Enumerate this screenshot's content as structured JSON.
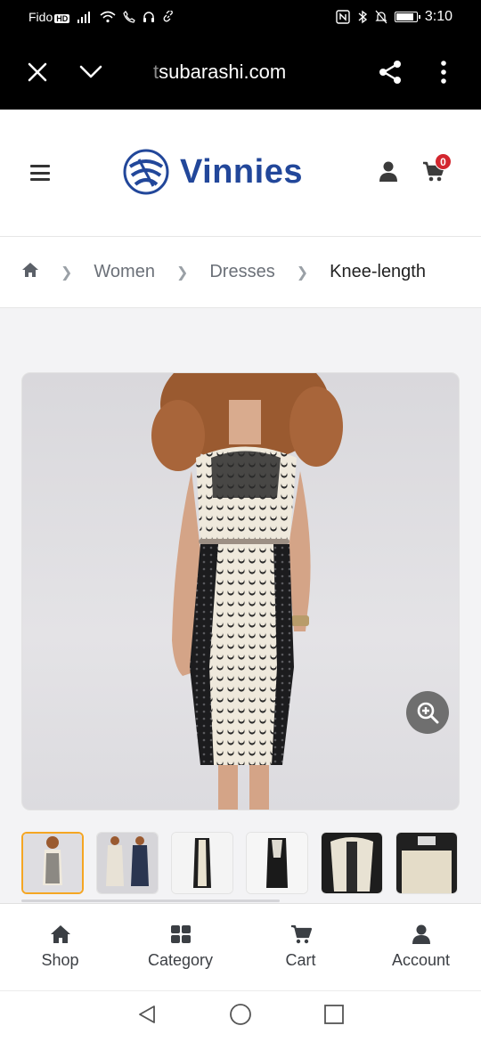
{
  "status_bar": {
    "carrier": "Fido",
    "carrier_badge": "HD",
    "time": "3:10",
    "battery_percent": 80,
    "icons": [
      "signal-icon",
      "wifi-icon",
      "call-icon",
      "headset-icon",
      "link-icon",
      "nfc-icon",
      "bluetooth-icon",
      "mute-icon",
      "battery-icon"
    ]
  },
  "browser": {
    "url_dim": "t",
    "url_rest": "subarashi.com",
    "icons": [
      "close-icon",
      "chevron-down-icon",
      "share-icon",
      "more-vert-icon"
    ]
  },
  "site": {
    "brand": "Vinnies",
    "brand_color": "#22479a",
    "cart_count": "0",
    "badge_color": "#d3262e"
  },
  "breadcrumb": {
    "items": [
      "Women",
      "Dresses",
      "Knee-length"
    ]
  },
  "gallery": {
    "thumbnail_count": 6,
    "active_index": 0,
    "active_color": "#f5a623"
  },
  "bottom_nav": {
    "items": [
      {
        "label": "Shop",
        "icon": "home-icon"
      },
      {
        "label": "Category",
        "icon": "grid-icon"
      },
      {
        "label": "Cart",
        "icon": "cart-icon"
      },
      {
        "label": "Account",
        "icon": "user-icon"
      }
    ]
  }
}
